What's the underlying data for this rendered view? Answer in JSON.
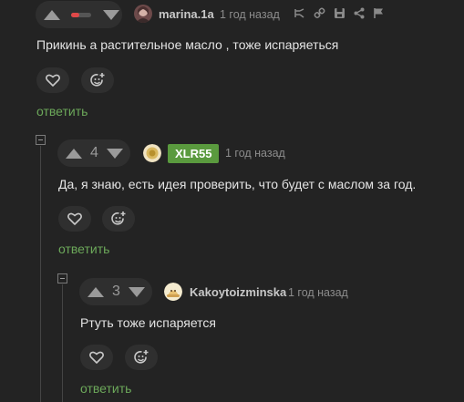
{
  "comments": [
    {
      "user": "marina.1a",
      "time": "1 год назад",
      "text": "Прикинь а растительное масло , тоже испаряеться",
      "reply_label": "ответить",
      "rating": "negative"
    },
    {
      "user": "XLR55",
      "time": "1 год назад",
      "votes": "4",
      "text": "Да, я знаю, есть идея проверить, что будет с маслом за год.",
      "reply_label": "ответить",
      "badge_color": "#5a9a3e"
    },
    {
      "user": "Kakoytoizminska",
      "time": "1 год назад",
      "votes": "3",
      "text": "Ртуть тоже испаряется",
      "reply_label": "ответить"
    }
  ],
  "colors": {
    "background": "#232323",
    "reply": "#6ca85a",
    "negative": "#e04848"
  },
  "icons": [
    "arrow-up-icon",
    "arrow-down-icon",
    "heart-icon",
    "emoji-add-icon",
    "share-tree-icon",
    "link-icon",
    "save-icon",
    "share-icon",
    "flag-icon",
    "collapse-icon"
  ]
}
